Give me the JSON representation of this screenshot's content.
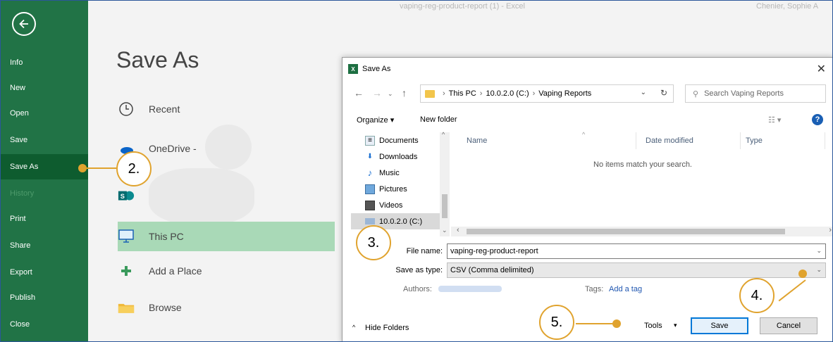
{
  "window": {
    "title": "vaping-reg-product-report (1) - Excel",
    "user": "Chenier, Sophie A"
  },
  "nav": {
    "items": [
      {
        "label": "Info"
      },
      {
        "label": "New"
      },
      {
        "label": "Open"
      },
      {
        "label": "Save"
      },
      {
        "label": "Save As"
      },
      {
        "label": "History"
      },
      {
        "label": "Print"
      },
      {
        "label": "Share"
      },
      {
        "label": "Export"
      },
      {
        "label": "Publish"
      },
      {
        "label": "Close"
      }
    ],
    "active": "Save As",
    "disabled": "History"
  },
  "main": {
    "title": "Save As",
    "locations": [
      {
        "label": "Recent",
        "icon": "clock-icon"
      },
      {
        "label": "OneDrive -",
        "icon": "cloud-icon"
      },
      {
        "label": "",
        "icon": "sharepoint-icon"
      },
      {
        "label": "This PC",
        "icon": "computer-icon"
      },
      {
        "label": "Add a Place",
        "icon": "plus-icon"
      },
      {
        "label": "Browse",
        "icon": "folder-icon"
      }
    ],
    "active_location": "This PC"
  },
  "dialog": {
    "title": "Save As",
    "address": {
      "crumbs": [
        "This PC",
        "10.0.2.0 (C:)",
        "Vaping Reports"
      ]
    },
    "search_placeholder": "Search Vaping Reports",
    "toolbar": {
      "organize": "Organize ▾",
      "new_folder": "New folder"
    },
    "tree": [
      {
        "label": "Documents",
        "icon": "documents-icon"
      },
      {
        "label": "Downloads",
        "icon": "downloads-icon"
      },
      {
        "label": "Music",
        "icon": "music-icon"
      },
      {
        "label": "Pictures",
        "icon": "pictures-icon"
      },
      {
        "label": "Videos",
        "icon": "videos-icon"
      },
      {
        "label": "10.0.2.0 (C:)",
        "icon": "drive-icon"
      }
    ],
    "columns": [
      "Name",
      "Date modified",
      "Type"
    ],
    "empty_message": "No items match your search.",
    "file_name_label": "File name:",
    "file_name_value": "vaping-reg-product-report",
    "save_type_label": "Save as type:",
    "save_type_value": "CSV (Comma delimited)",
    "authors_label": "Authors:",
    "tags_label": "Tags:",
    "tags_value": "Add a tag",
    "hide_folders": "Hide Folders",
    "tools": "Tools",
    "save": "Save",
    "cancel": "Cancel"
  },
  "callouts": [
    "2.",
    "3.",
    "4.",
    "5."
  ],
  "colors": {
    "nav_green": "#217346",
    "nav_active": "#0e5c2f",
    "callout": "#e0a32e",
    "location_active": "#a9d9b7"
  }
}
